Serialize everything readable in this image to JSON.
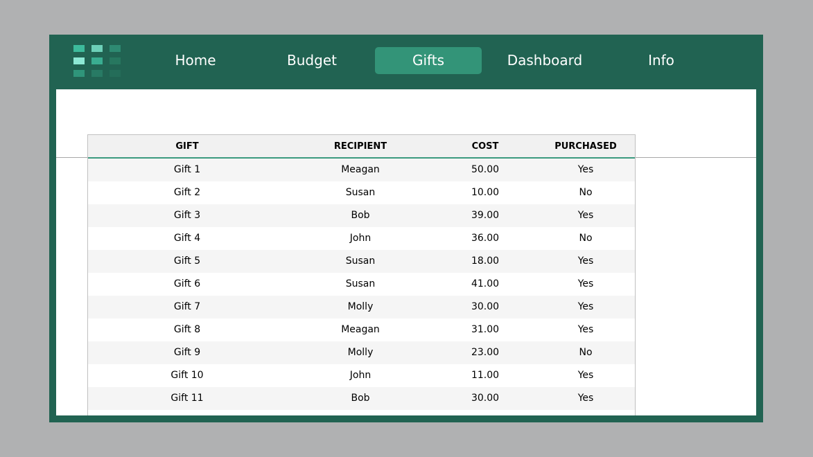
{
  "nav": {
    "items": [
      {
        "label": "Home",
        "active": false
      },
      {
        "label": "Budget",
        "active": false
      },
      {
        "label": "Gifts",
        "active": true
      },
      {
        "label": "Dashboard",
        "active": false
      },
      {
        "label": "Info",
        "active": false
      }
    ]
  },
  "logo": {
    "icon": "grid-logo-icon",
    "colors": [
      "#3dbb9b",
      "#6dd0b8",
      "#2e8a72",
      "#8de8d4",
      "#3aad91",
      "#27775f",
      "#2f957a",
      "#287a64",
      "#246d59"
    ]
  },
  "colors": {
    "frame": "#216352",
    "active_tab": "#339478",
    "accent_line": "#3a9a7e"
  },
  "table": {
    "headers": [
      "GIFT",
      "RECIPIENT",
      "COST",
      "PURCHASED"
    ],
    "rows": [
      [
        "Gift 1",
        "Meagan",
        "50.00",
        "Yes"
      ],
      [
        "Gift 2",
        "Susan",
        "10.00",
        "No"
      ],
      [
        "Gift 3",
        "Bob",
        "39.00",
        "Yes"
      ],
      [
        "Gift 4",
        "John",
        "36.00",
        "No"
      ],
      [
        "Gift 5",
        "Susan",
        "18.00",
        "Yes"
      ],
      [
        "Gift 6",
        "Susan",
        "41.00",
        "Yes"
      ],
      [
        "Gift 7",
        "Molly",
        "30.00",
        "Yes"
      ],
      [
        "Gift 8",
        "Meagan",
        "31.00",
        "Yes"
      ],
      [
        "Gift 9",
        "Molly",
        "23.00",
        "No"
      ],
      [
        "Gift 10",
        "John",
        "11.00",
        "Yes"
      ],
      [
        "Gift 11",
        "Bob",
        "30.00",
        "Yes"
      ]
    ]
  }
}
